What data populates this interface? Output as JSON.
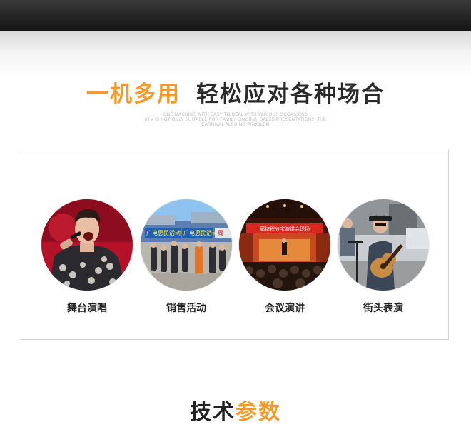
{
  "header": {
    "headline_accent": "一机多用",
    "headline_main": "轻松应对各种场合",
    "subtitle_lines": [
      "ONE MACHINE WITH EASY TO DEAL WITH VARIOUS OCCASIONS",
      "KTV IS NOT ONLY SUITABLE FOR FAMILY SINGING, SALES PRESENTATIONS, THE",
      "CARNIVAL ALSO NO PROBLEM"
    ]
  },
  "scenes": [
    {
      "caption": "舞台演唱"
    },
    {
      "caption": "销售活动",
      "signs": [
        "广电惠民活动",
        "广电惠民活动",
        "周"
      ]
    },
    {
      "caption": "会议演讲",
      "banner": "廊坊积分宝演讲会现场"
    },
    {
      "caption": "街头表演"
    }
  ],
  "section_next": {
    "title_main": "技术",
    "title_accent": "参数"
  },
  "colors": {
    "accent": "#f39a2b",
    "dark_text": "#2a2a2a",
    "border": "#d2d2d2"
  }
}
